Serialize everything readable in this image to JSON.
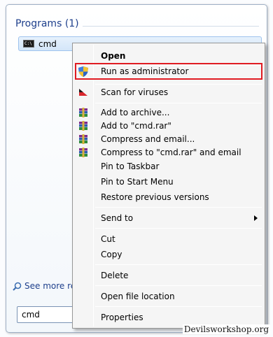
{
  "start_menu": {
    "group_header": "Programs (1)",
    "result_label": "cmd",
    "result_icon": "command-prompt-icon",
    "see_more_label": "See more res",
    "search_value": "cmd"
  },
  "context_menu": {
    "items": [
      {
        "label": "Open",
        "bold": true
      },
      {
        "label": "Run as administrator",
        "icon": "uac-shield-icon",
        "highlighted": true
      },
      {
        "label": "Scan for viruses",
        "icon": "antivirus-icon"
      },
      {
        "label": "Add to archive...",
        "icon": "winrar-icon"
      },
      {
        "label": "Add to \"cmd.rar\"",
        "icon": "winrar-icon"
      },
      {
        "label": "Compress and email...",
        "icon": "winrar-icon"
      },
      {
        "label": "Compress to \"cmd.rar\" and email",
        "icon": "winrar-icon"
      },
      {
        "label": "Pin to Taskbar"
      },
      {
        "label": "Pin to Start Menu"
      },
      {
        "label": "Restore previous versions"
      },
      {
        "label": "Send to",
        "submenu": true
      },
      {
        "label": "Cut"
      },
      {
        "label": "Copy"
      },
      {
        "label": "Delete"
      },
      {
        "label": "Open file location"
      },
      {
        "label": "Properties"
      }
    ],
    "highlight_color": "#e01b22"
  },
  "watermark": "Devilsworkshop.org"
}
